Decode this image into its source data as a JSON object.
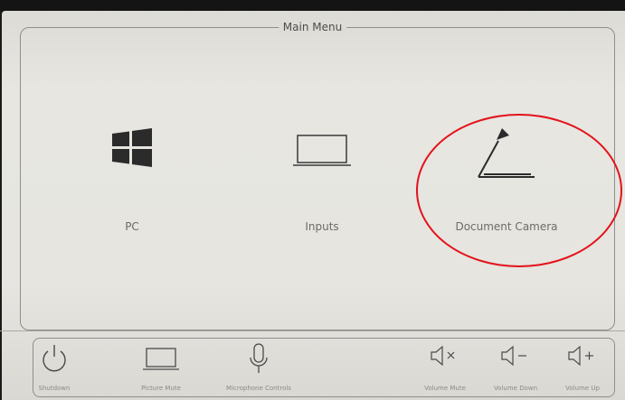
{
  "window": {
    "title": "Main Menu"
  },
  "tiles": [
    {
      "label": "PC",
      "icon": "windows-logo-icon"
    },
    {
      "label": "Inputs",
      "icon": "laptop-icon"
    },
    {
      "label": "Document Camera",
      "icon": "document-camera-icon"
    }
  ],
  "bottom_bar": {
    "shutdown": "Shutdown",
    "picture_mute": "Picture Mute",
    "microphone_controls": "Microphone Controls",
    "volume_mute": "Volume Mute",
    "volume_down": "Volume Down",
    "volume_up": "Volume Up"
  },
  "colors": {
    "panel": "#e4e3de",
    "frame": "#8e8e8b",
    "icon": "#2b2b2b",
    "annotation_circle": "#e4121b"
  }
}
